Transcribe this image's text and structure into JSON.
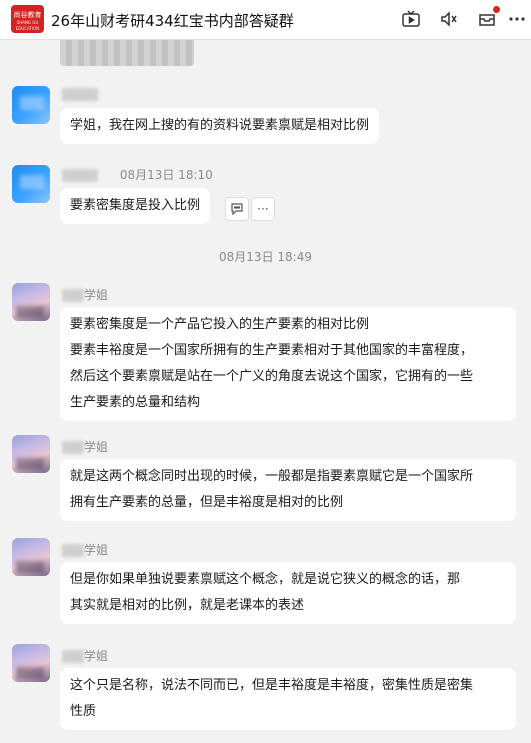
{
  "header": {
    "logo_text": "尚谷教育",
    "logo_subtext": "SHANG GU EDUCATION",
    "title": "26年山财考研434红宝书内部答疑群",
    "icons": [
      "video-icon",
      "mute-icon",
      "inbox-icon",
      "more-icon"
    ]
  },
  "colors": {
    "brand": "#d62222",
    "bubble": "#ffffff",
    "background": "#f2f2f2",
    "unread": "#e02020"
  },
  "messages": [
    {
      "sender_suffix": "",
      "time": "",
      "text": "学姐，我在网上搜的有的资料说要素禀赋是相对比例"
    },
    {
      "sender_suffix": "",
      "time": "08月13日 18:10",
      "text": "要素密集度是投入比例"
    },
    {
      "sender_suffix": "学姐",
      "time": "",
      "lines": [
        "要素密集度是一个产品它投入的生产要素的相对比例",
        "要素丰裕度是一个国家所拥有的生产要素相对于其他国家的丰富程度，",
        "然后这个要素禀赋是站在一个广义的角度去说这个国家，它拥有的一些",
        "生产要素的总量和结构"
      ]
    },
    {
      "sender_suffix": "学姐",
      "time": "",
      "lines": [
        "就是这两个概念同时出现的时候，一般都是指要素禀赋它是一个国家所",
        "拥有生产要素的总量，但是丰裕度是相对的比例"
      ]
    },
    {
      "sender_suffix": "学姐",
      "time": "",
      "lines": [
        "但是你如果单独说要素禀赋这个概念，就是说它狭义的概念的话，那",
        "其实就是相对的比例，就是老课本的表述"
      ]
    },
    {
      "sender_suffix": "学姐",
      "time": "",
      "lines": [
        "这个只是名称，说法不同而已，但是丰裕度是丰裕度，密集性质是密集",
        "性质"
      ]
    }
  ],
  "timestamp_divider": "08月13日 18:49",
  "message_actions": {
    "reply_icon": "comment-icon",
    "more_label": "···"
  }
}
